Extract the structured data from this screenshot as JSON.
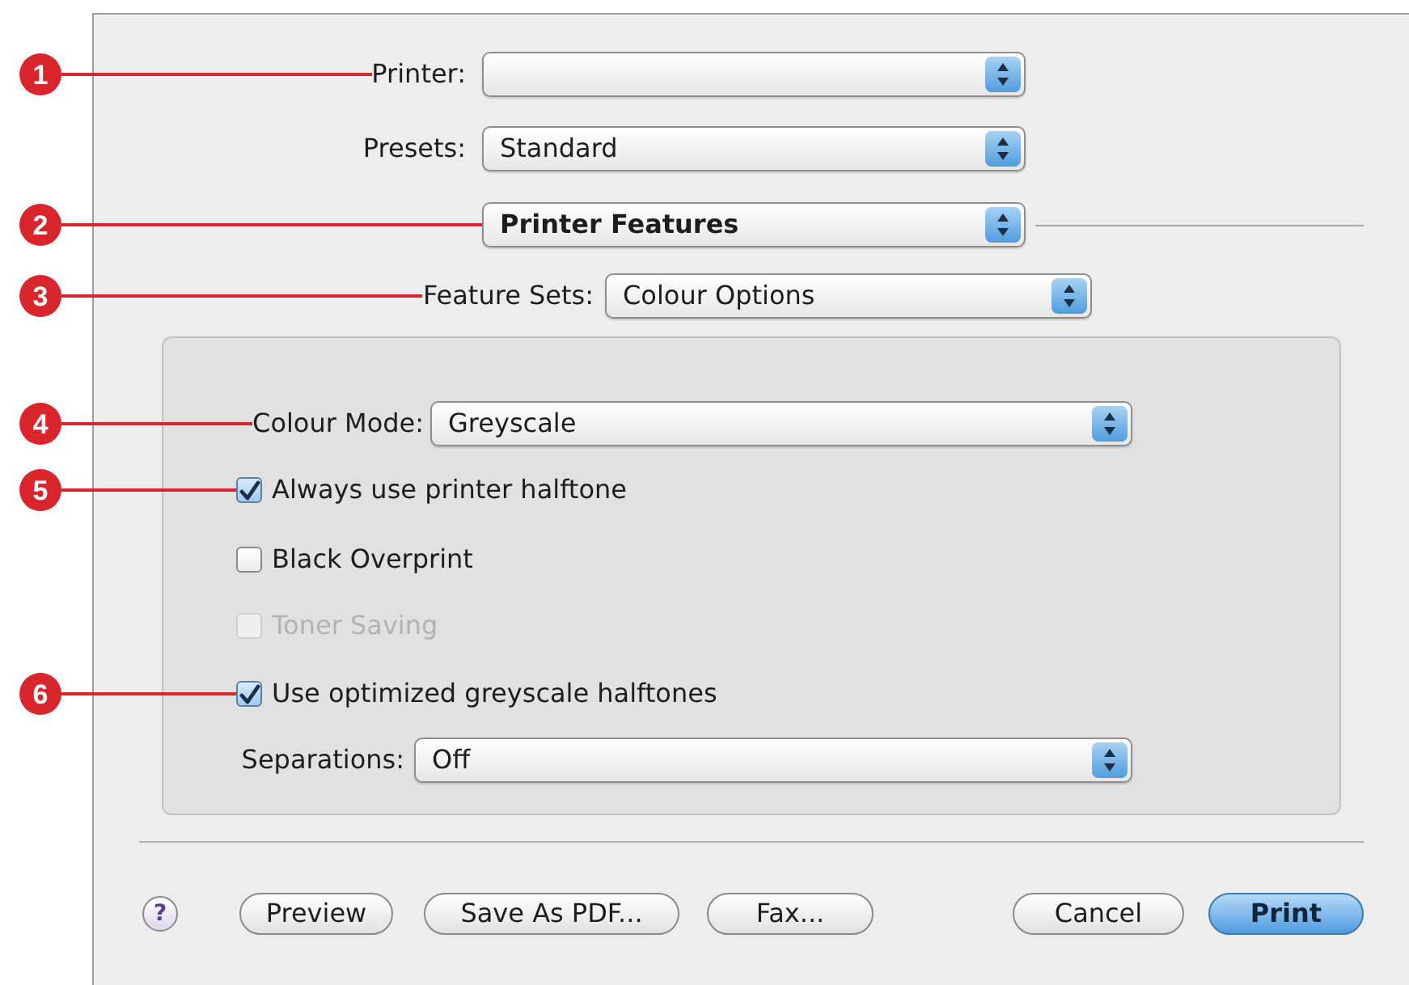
{
  "top_rows": [
    {
      "kind": "popup",
      "label": "Printer:",
      "callout": "1"
    },
    {
      "kind": "popup",
      "label": "Presets:",
      "value": "Standard"
    },
    {
      "kind": "pane_popup",
      "value": "Printer Features",
      "callout": "2"
    },
    {
      "kind": "popup",
      "label": "Feature Sets:",
      "value": "Colour Options",
      "callout": "3"
    }
  ],
  "panel": {
    "rows": [
      {
        "kind": "popup",
        "label": "Colour Mode:",
        "value": "Greyscale",
        "callout": "4"
      },
      {
        "kind": "checkbox",
        "label": "Always use printer halftone",
        "checked": true,
        "disabled": false,
        "callout": "5"
      },
      {
        "kind": "checkbox",
        "label": "Black Overprint",
        "checked": false,
        "disabled": false
      },
      {
        "kind": "checkbox",
        "label": "Toner Saving",
        "checked": false,
        "disabled": true
      },
      {
        "kind": "checkbox",
        "label": "Use optimized greyscale halftones",
        "checked": true,
        "disabled": false,
        "callout": "6"
      },
      {
        "kind": "popup",
        "label": "Separations:",
        "value": "Off"
      }
    ]
  },
  "help_button": {
    "label": "?"
  },
  "left_buttons": [
    {
      "label": "Preview",
      "default": false
    },
    {
      "label": "Save As PDF...",
      "default": false
    },
    {
      "label": "Fax...",
      "default": false
    }
  ],
  "right_buttons": [
    {
      "label": "Cancel",
      "default": false
    },
    {
      "label": "Print",
      "default": true
    }
  ]
}
